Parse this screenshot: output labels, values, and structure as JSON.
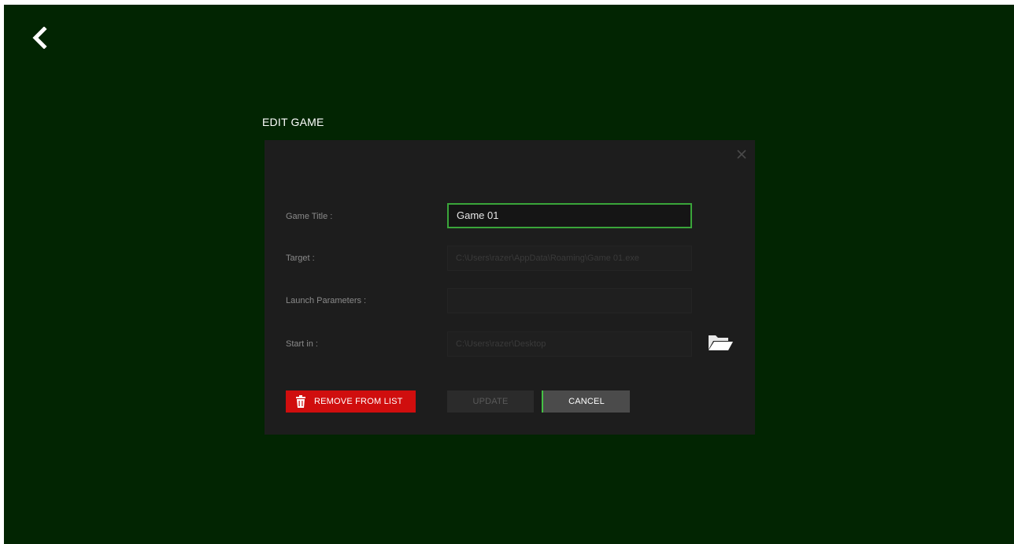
{
  "page": {
    "title": "EDIT GAME",
    "back_icon": "chevron-left-icon"
  },
  "dialog": {
    "close_icon": "close-icon",
    "fields": [
      {
        "label": "Game Title :",
        "value": "Game 01"
      },
      {
        "label": "Target :",
        "value": "C:\\Users\\razer\\AppData\\Roaming\\Game 01.exe"
      },
      {
        "label": "Launch Parameters :",
        "value": ""
      },
      {
        "label": "Start in :",
        "value": "C:\\Users\\razer\\Desktop"
      }
    ],
    "folder_icon": "folder-open-icon",
    "remove_label": "REMOVE FROM LIST",
    "remove_icon": "trash-icon",
    "update_label": "UPDATE",
    "cancel_label": "CANCEL"
  },
  "colors": {
    "background": "#022502",
    "dialog": "#1d1d1d",
    "accent": "#3aa53a",
    "danger": "#d00e0e"
  }
}
